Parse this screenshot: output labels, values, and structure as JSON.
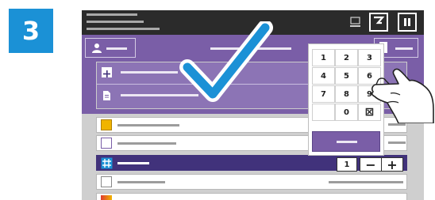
{
  "step_number": "3",
  "keypad": {
    "keys": [
      "1",
      "2",
      "3",
      "4",
      "5",
      "6",
      "7",
      "8",
      "9",
      "",
      "0",
      "⊠"
    ]
  },
  "quantity": {
    "value": "1",
    "minus": "−",
    "plus": "+"
  },
  "icons": {
    "user": "user-icon",
    "check": "checkmark-icon",
    "hand": "pointing-hand-icon",
    "hash": "hash-icon"
  },
  "colors": {
    "accent": "#1b91d6",
    "purple": "#7a5ea7",
    "selected_row": "#41327b"
  }
}
